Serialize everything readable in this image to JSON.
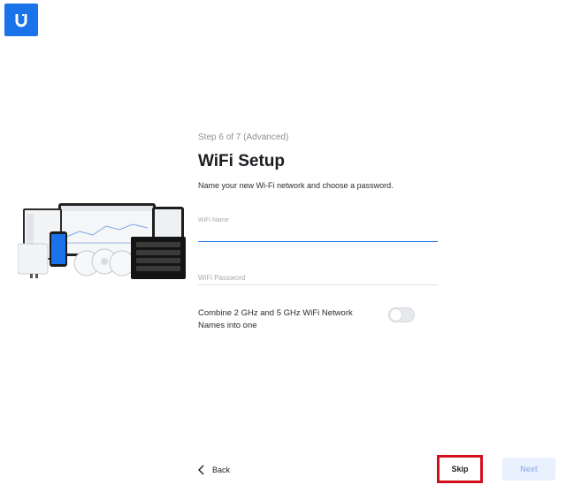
{
  "brand": {
    "logo_letter": "U",
    "color": "#1a73e8"
  },
  "wizard": {
    "step": "Step 6 of 7 (Advanced)",
    "title": "WiFi Setup",
    "subtitle": "Name your new Wi-Fi network and choose a password."
  },
  "fields": {
    "wifi_name": {
      "label": "WiFi Name",
      "value": ""
    },
    "wifi_password": {
      "label": "WiFi Password",
      "value": ""
    }
  },
  "combine_toggle": {
    "label": "Combine 2 GHz and 5 GHz WiFi Network Names into one",
    "on": false
  },
  "footer": {
    "back_label": "Back",
    "skip_label": "Skip",
    "next_label": "Next"
  },
  "colors": {
    "highlight": "#d2101d",
    "next_disabled_bg": "#e8f1fd"
  }
}
